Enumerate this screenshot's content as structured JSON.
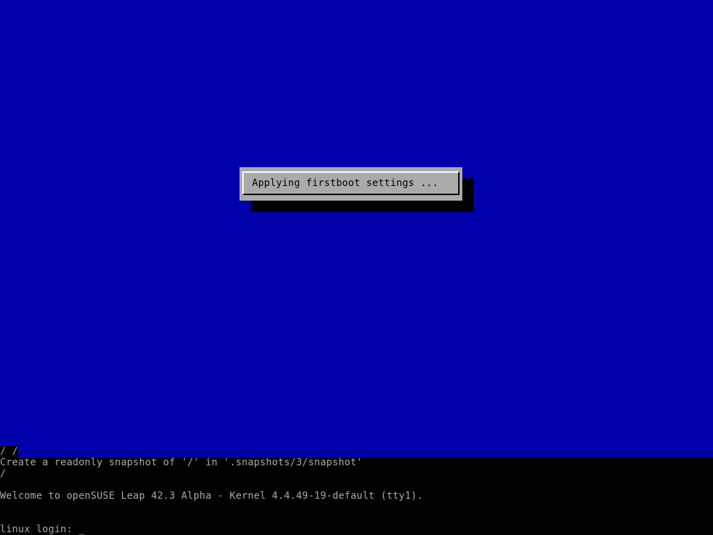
{
  "colors": {
    "background_blue": "#0000aa",
    "dialog_gray": "#aaaaaa",
    "terminal_text": "#aaaaaa",
    "terminal_bg": "#000000"
  },
  "dialog": {
    "message": "Applying firstboot settings ..."
  },
  "terminal": {
    "lines": [
      "/ /",
      "Create a readonly snapshot of '/' in '.snapshots/3/snapshot'",
      "/",
      "",
      "Welcome to openSUSE Leap 42.3 Alpha - Kernel 4.4.49-19-default (tty1).",
      "",
      "",
      "linux login: _"
    ]
  }
}
